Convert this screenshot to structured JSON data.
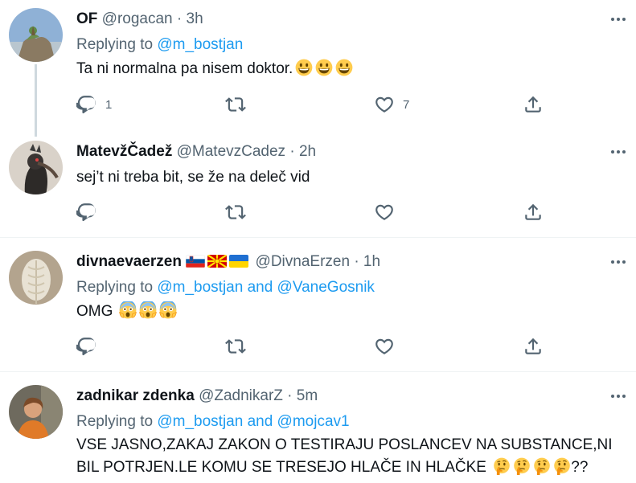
{
  "tweets": [
    {
      "name": "OF",
      "handle": "@rogacan",
      "dot": "·",
      "time": "3h",
      "reply_prefix": "Replying to",
      "reply_to": "@m_bostjan",
      "text": "Ta ni normalna pa nisem doktor.",
      "emojis": [
        "grinning-face",
        "grinning-face",
        "grinning-face"
      ],
      "reply_count": "1",
      "like_count": "7"
    },
    {
      "name": "MatevžČadež",
      "handle": "@MatevzCadez",
      "dot": "·",
      "time": "2h",
      "text": "sej’t ni treba bit, se že na deleč vid"
    },
    {
      "name": "divnaevaerzen",
      "flags": [
        "slovenia-flag",
        "north-macedonia-flag",
        "ukraine-flag"
      ],
      "handle": "@DivnaErzen",
      "dot": "·",
      "time": "1h",
      "reply_prefix": "Replying to",
      "reply_to": "@m_bostjan and @VaneGosnik",
      "text": "OMG",
      "emojis": [
        "screaming-face",
        "screaming-face",
        "screaming-face"
      ]
    },
    {
      "name": "zadnikar zdenka",
      "handle": "@ZadnikarZ",
      "dot": "·",
      "time": "5m",
      "reply_prefix": "Replying to",
      "reply_to": "@m_bostjan and @mojcav1",
      "text_line1": "VSE JASNO,ZAKAJ ZAKON O TESTIRAJU POSLANCEV NA SUBSTANCE,NI",
      "text_line2": "BIL POTRJEN.LE KOMU SE TRESEJO HLAČE IN HLAČKE",
      "emojis": [
        "thinking-face",
        "thinking-face",
        "thinking-face",
        "thinking-face"
      ],
      "text_suffix": "??"
    }
  ],
  "colors": {
    "text": "#0f1419",
    "secondary": "#536471",
    "link": "#1d9bf0",
    "divider": "#eff3f4",
    "thread_line": "#cfd9de"
  }
}
